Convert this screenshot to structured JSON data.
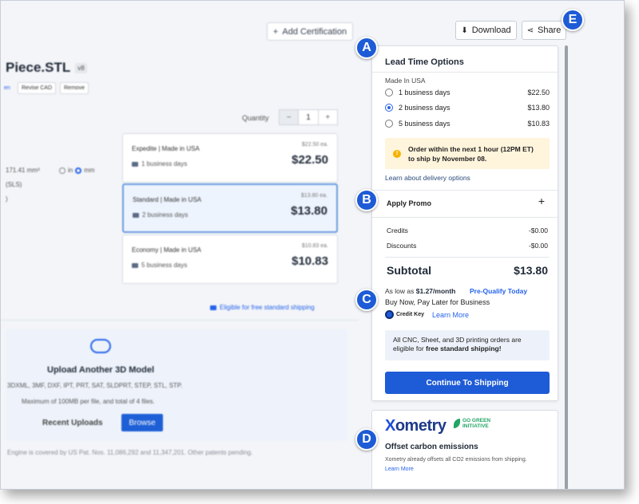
{
  "left": {
    "add_certification": "Add Certification",
    "file_name": "Piece.STL",
    "version": "v8",
    "actions": [
      "en",
      "Revise CAD",
      "Remove"
    ],
    "quantity_label": "Quantity",
    "quantity_value": "1",
    "dimensions": "171.41 mm³",
    "units": [
      "in",
      "mm"
    ],
    "process": "(SLS)",
    "extra": ")",
    "price_cards": [
      {
        "name": "Expedite | Made in USA",
        "days": "1 business days",
        "each": "$22.50 ea.",
        "price": "$22.50"
      },
      {
        "name": "Standard | Made in USA",
        "days": "2 business days",
        "each": "$13.80 ea.",
        "price": "$13.80"
      },
      {
        "name": "Economy | Made in USA",
        "days": "5 business days",
        "each": "$10.83 ea.",
        "price": "$10.83"
      }
    ],
    "free_shipping": "Eligible for free standard shipping",
    "upload_title": "Upload Another 3D Model",
    "upload_formats": "3DXML, 3MF, DXF, IPT, PRT, SAT, SLDPRT, STEP, STL, STP.",
    "upload_max": "Maximum of 100MB per file, and total of 4 files.",
    "recent_uploads": "Recent Uploads",
    "browse": "Browse",
    "patent": "Engine is covered by US Pat. Nos. 11,086,292 and 11,347,201. Other patents pending."
  },
  "top": {
    "download": "Download",
    "share": "Share"
  },
  "panel": {
    "title": "Lead Time Options",
    "made_in": "Made In USA",
    "options": [
      {
        "label": "1 business days",
        "price": "$22.50",
        "selected": false
      },
      {
        "label": "2 business days",
        "price": "$13.80",
        "selected": true
      },
      {
        "label": "5 business days",
        "price": "$10.83",
        "selected": false
      }
    ],
    "notice_line1": "Order within the next 1 hour (12PM ET)",
    "notice_line2": "to ship by November 08.",
    "learn_delivery": "Learn about delivery options",
    "apply_promo": "Apply Promo",
    "promo_plus": "+",
    "credits_label": "Credits",
    "credits_value": "-$0.00",
    "discounts_label": "Discounts",
    "discounts_value": "-$0.00",
    "subtotal_label": "Subtotal",
    "subtotal_value": "$13.80",
    "as_low_prefix": "As low as ",
    "as_low_amount": "$1.27/month",
    "prequalify": "Pre-Qualify Today",
    "bnpl": "Buy Now, Pay Later for Business",
    "credit_key": "Credit Key",
    "ck_learn": "Learn More",
    "ship_note_prefix": "All CNC, Sheet, and 3D printing orders are eligible for ",
    "ship_note_bold": "free standard shipping!",
    "continue": "Continue To Shipping"
  },
  "panel2": {
    "logo": "ometry",
    "logo_x": "X",
    "gogreen_1": "GO GREEN",
    "gogreen_2": "INITIATIVE",
    "offset_title": "Offset carbon emissions",
    "offset_desc": "Xometry already offsets all CO2 emissions from shipping.",
    "offset_learn": "Learn More"
  },
  "markers": [
    "A",
    "B",
    "C",
    "D",
    "E"
  ]
}
